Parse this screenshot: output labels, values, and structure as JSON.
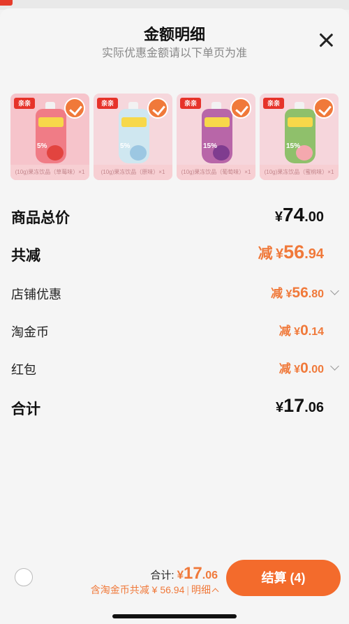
{
  "sheet": {
    "title": "金额明细",
    "subtitle": "实际优惠金额请以下单页为准"
  },
  "products": [
    {
      "brand": "亲亲",
      "caption": "(10g)果冻饮品（草莓味）×1",
      "pct": "5%",
      "fruit": "strawberry",
      "color": "#f6c4cb",
      "pouch_color": "#f07c86",
      "fruit_color": "#e2443f",
      "selected": true
    },
    {
      "brand": "亲亲",
      "caption": "(10g)果冻饮品（原味）×1",
      "pct": "5%",
      "fruit": "yogurt",
      "color": "#f6d7dc",
      "pouch_color": "#cfe7f0",
      "fruit_color": "#9cc7e2",
      "selected": true
    },
    {
      "brand": "亲亲",
      "caption": "(10g)果冻饮品（葡萄味）×1",
      "pct": "15%",
      "fruit": "grape",
      "color": "#f6d6dc",
      "pouch_color": "#b866a8",
      "fruit_color": "#7f3c8f",
      "selected": true
    },
    {
      "brand": "亲亲",
      "caption": "(10g)果冻饮品（蜜桃味）×1",
      "pct": "15%",
      "fruit": "peach",
      "color": "#f6d6dc",
      "pouch_color": "#8fc06b",
      "fruit_color": "#f4a8ae",
      "selected": true
    }
  ],
  "rows": {
    "goods_total": {
      "label": "商品总价",
      "currency": "¥",
      "int": "74",
      "dec": ".00"
    },
    "total_reduction": {
      "label": "共减",
      "prefix": "减",
      "currency": "¥",
      "int": "56",
      "dec": ".94"
    },
    "store_discount": {
      "label": "店铺优惠",
      "prefix": "减",
      "currency": "¥",
      "int": "56",
      "dec": ".80"
    },
    "taobao_coins": {
      "label": "淘金币",
      "prefix": "减",
      "currency": "¥",
      "int": "0",
      "dec": ".14"
    },
    "red_packet": {
      "label": "红包",
      "prefix": "减",
      "currency": "¥",
      "int": "0",
      "dec": ".00"
    },
    "subtotal": {
      "label": "合计",
      "currency": "¥",
      "int": "17",
      "dec": ".06"
    }
  },
  "bottom": {
    "total_label": "合计:",
    "currency": "¥",
    "int": "17",
    "dec": ".06",
    "discount_text": "含淘金币共减 ¥ 56.94",
    "separator": "|",
    "detail_label": "明细",
    "checkout_label": "结算 (4)"
  },
  "colors": {
    "accent": "#f36b2c",
    "price_orange": "#f0793a",
    "text_dark": "#111111",
    "text_gray": "#888888"
  }
}
